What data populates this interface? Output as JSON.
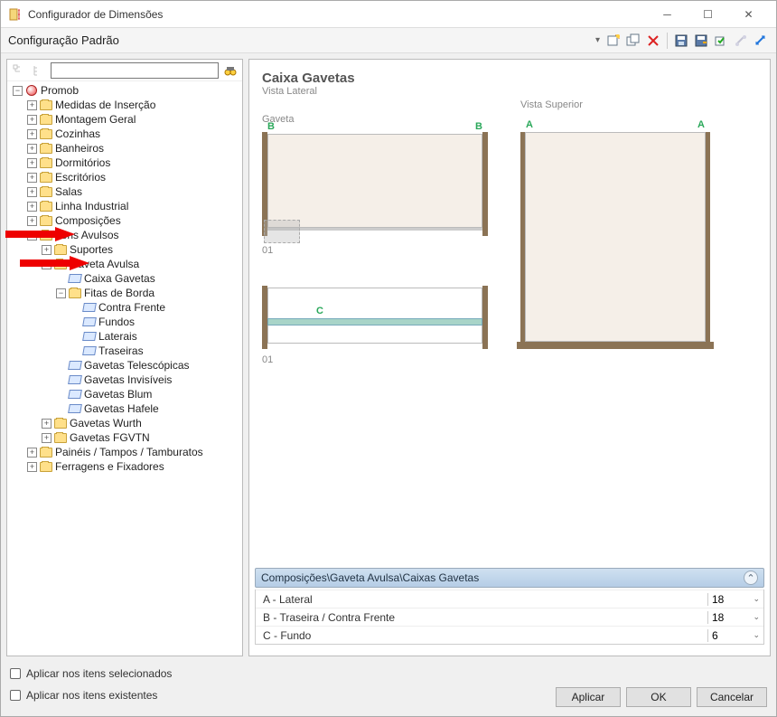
{
  "window": {
    "title": "Configurador de Dimensões"
  },
  "header": {
    "config_label": "Configuração Padrão"
  },
  "search": {
    "placeholder": ""
  },
  "tree": {
    "root": "Promob",
    "items": [
      "Medidas de Inserção",
      "Montagem Geral",
      "Cozinhas",
      "Banheiros",
      "Dormitórios",
      "Escritórios",
      "Salas",
      "Linha Industrial",
      "Composições",
      "Itens Avulsos"
    ],
    "avulsos": {
      "suportes": "Suportes",
      "gaveta": {
        "label": "Gaveta Avulsa",
        "caixa": "Caixa Gavetas",
        "fitas": {
          "label": "Fitas de Borda",
          "items": [
            "Contra Frente",
            "Fundos",
            "Laterais",
            "Traseiras"
          ]
        },
        "tele": "Gavetas Telescópicas",
        "invis": "Gavetas Invisíveis",
        "blum": "Gavetas Blum",
        "hafele": "Gavetas Hafele",
        "wurth": "Gavetas Wurth",
        "fgvtn": "Gavetas FGVTN"
      }
    },
    "paineis": "Painéis / Tampos / Tamburatos",
    "ferragens": "Ferragens e Fixadores"
  },
  "diagram": {
    "title": "Caixa Gavetas",
    "v1": "Vista Lateral",
    "v2": "Vista Superior",
    "gaveta": "Gaveta",
    "B": "B",
    "A": "A",
    "C": "C",
    "o1a": "01",
    "o1b": "01"
  },
  "props": {
    "path": "Composições\\Gaveta Avulsa\\Caixas Gavetas",
    "rows": [
      {
        "label": "A - Lateral",
        "value": "18"
      },
      {
        "label": "B - Traseira / Contra Frente",
        "value": "18"
      },
      {
        "label": "C - Fundo",
        "value": "6"
      }
    ]
  },
  "checks": {
    "sel": "Aplicar nos itens selecionados",
    "exist": "Aplicar nos itens existentes"
  },
  "buttons": {
    "apply": "Aplicar",
    "ok": "OK",
    "cancel": "Cancelar"
  }
}
